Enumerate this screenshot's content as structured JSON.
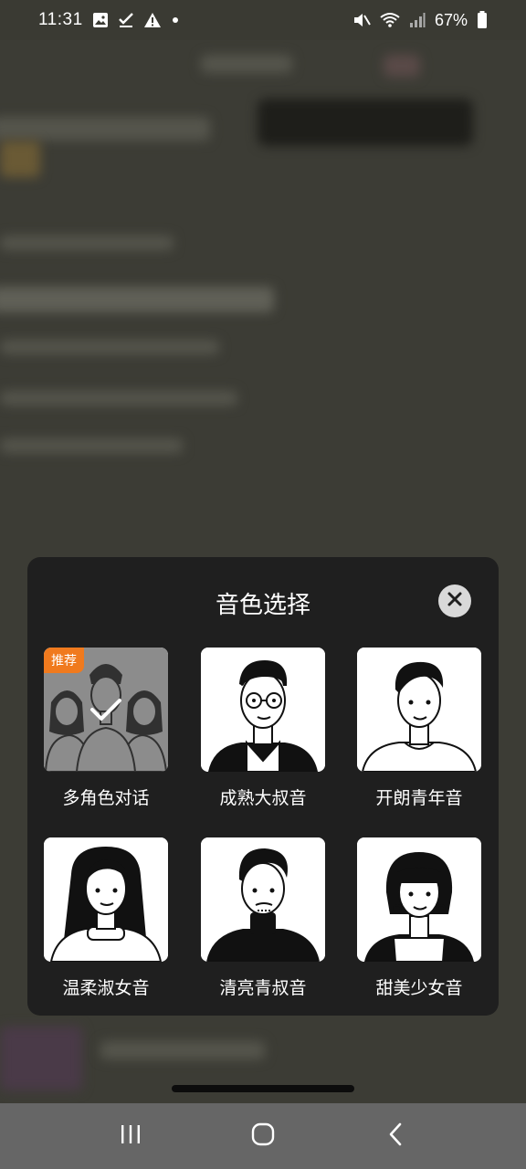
{
  "status_bar": {
    "time": "11:31",
    "battery_text": "67%",
    "icons": [
      "image-icon",
      "check-icon",
      "warning-icon",
      "dot-icon",
      "mute-icon",
      "wifi-icon",
      "signal-icon",
      "battery-icon"
    ]
  },
  "modal": {
    "title": "音色选择",
    "close_icon": "close-icon",
    "badge": "推荐",
    "voices": [
      {
        "label": "多角色对话",
        "selected": true
      },
      {
        "label": "成熟大叔音",
        "selected": false
      },
      {
        "label": "开朗青年音",
        "selected": false
      },
      {
        "label": "温柔淑女音",
        "selected": false
      },
      {
        "label": "清亮青叔音",
        "selected": false
      },
      {
        "label": "甜美少女音",
        "selected": false
      }
    ]
  },
  "nav": {
    "recent": "recent-apps-icon",
    "home": "home-icon",
    "back": "back-icon"
  },
  "colors": {
    "accent": "#f07a1e",
    "modal_bg": "#1f1f1f",
    "overlay": "#3c3c35"
  }
}
